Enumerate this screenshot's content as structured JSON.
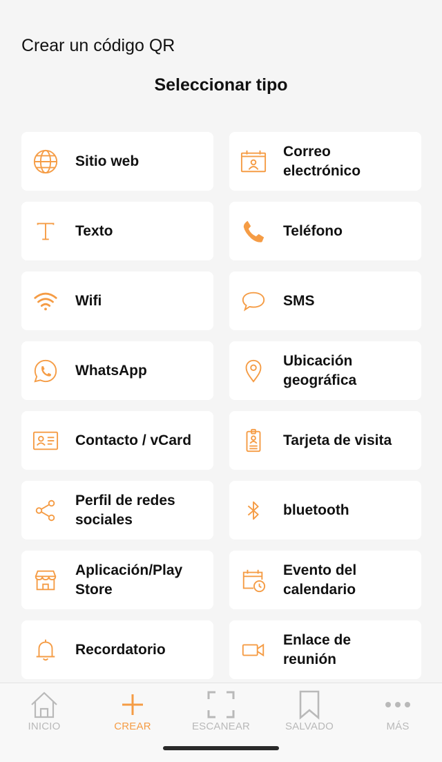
{
  "header": {
    "app_title": "Crear un código QR",
    "section_title": "Seleccionar tipo"
  },
  "accent_color": "#f59c45",
  "types": [
    {
      "label": "Sitio web",
      "icon": "globe-icon"
    },
    {
      "label": "Correo\nelectrónico",
      "icon": "email-card-icon"
    },
    {
      "label": "Texto",
      "icon": "text-icon"
    },
    {
      "label": "Teléfono",
      "icon": "phone-icon"
    },
    {
      "label": "Wifi",
      "icon": "wifi-icon"
    },
    {
      "label": "SMS",
      "icon": "chat-bubble-icon"
    },
    {
      "label": "WhatsApp",
      "icon": "whatsapp-icon"
    },
    {
      "label": "Ubicación\ngeográfica",
      "icon": "location-pin-icon"
    },
    {
      "label": "Contacto / vCard",
      "icon": "contact-card-icon"
    },
    {
      "label": "Tarjeta de visita",
      "icon": "badge-icon"
    },
    {
      "label": "Perfil de redes\nsociales",
      "icon": "share-icon"
    },
    {
      "label": "bluetooth",
      "icon": "bluetooth-icon"
    },
    {
      "label": "Aplicación/Play\nStore",
      "icon": "store-icon"
    },
    {
      "label": "Evento del\ncalendario",
      "icon": "calendar-clock-icon"
    },
    {
      "label": "Recordatorio",
      "icon": "bell-icon"
    },
    {
      "label": "Enlace de\nreunión",
      "icon": "video-camera-icon"
    }
  ],
  "nav": {
    "home": "INICIO",
    "create": "CREAR",
    "scan": "ESCANEAR",
    "saved": "SALVADO",
    "more": "MÁS"
  }
}
